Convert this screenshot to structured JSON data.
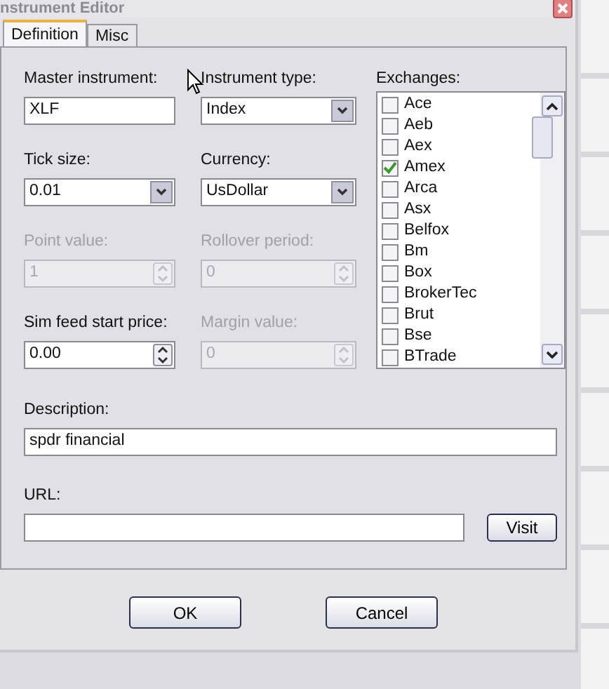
{
  "window": {
    "title": "nstrument Editor"
  },
  "tabs": [
    {
      "label": "Definition",
      "selected": true
    },
    {
      "label": "Misc",
      "selected": false
    }
  ],
  "fields": [
    {
      "kind": "text",
      "label": "Master instrument:",
      "value": "XLF",
      "disabled": false
    },
    {
      "kind": "combo",
      "label": "Instrument type:",
      "value": "Index",
      "disabled": false
    },
    {
      "kind": "combo",
      "label": "Tick size:",
      "value": "0.01",
      "disabled": false
    },
    {
      "kind": "combo",
      "label": "Currency:",
      "value": "UsDollar",
      "disabled": false
    },
    {
      "kind": "spin",
      "label": "Point value:",
      "value": "1",
      "disabled": true
    },
    {
      "kind": "spin",
      "label": "Rollover period:",
      "value": "0",
      "disabled": true
    },
    {
      "kind": "spin",
      "label": "Sim feed start price:",
      "value": "0.00",
      "disabled": false
    },
    {
      "kind": "spin",
      "label": "Margin value:",
      "value": "0",
      "disabled": true
    }
  ],
  "exchanges": {
    "label": "Exchanges:",
    "items": [
      {
        "name": "Ace",
        "checked": false
      },
      {
        "name": "Aeb",
        "checked": false
      },
      {
        "name": "Aex",
        "checked": false
      },
      {
        "name": "Amex",
        "checked": true
      },
      {
        "name": "Arca",
        "checked": false
      },
      {
        "name": "Asx",
        "checked": false
      },
      {
        "name": "Belfox",
        "checked": false
      },
      {
        "name": "Bm",
        "checked": false
      },
      {
        "name": "Box",
        "checked": false
      },
      {
        "name": "BrokerTec",
        "checked": false
      },
      {
        "name": "Brut",
        "checked": false
      },
      {
        "name": "Bse",
        "checked": false
      },
      {
        "name": "BTrade",
        "checked": false
      }
    ]
  },
  "description": {
    "label": "Description:",
    "value": "spdr financial"
  },
  "url": {
    "label": "URL:",
    "button": "Visit"
  },
  "buttons": [
    "OK",
    "Cancel"
  ]
}
